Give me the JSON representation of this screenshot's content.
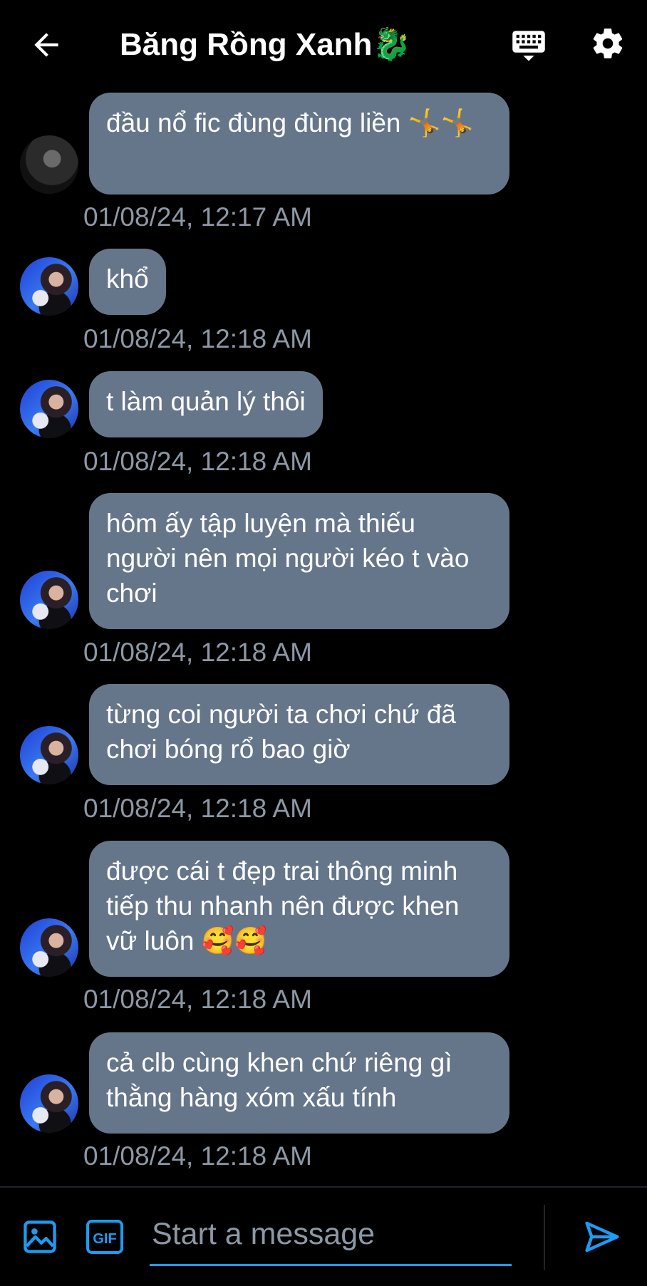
{
  "header": {
    "title": "Băng Rồng Xanh🐉",
    "back_icon": "arrow-left-icon",
    "keyboard_icon": "keyboard-icon",
    "settings_icon": "gear-icon"
  },
  "colors": {
    "bubble": "#66768a",
    "timestamp": "#8d98a6",
    "accent": "#1d9bf0",
    "background": "#000000"
  },
  "messages": [
    {
      "text": "đầu nổ fic đùng đùng liền 🤸🤸",
      "time": "01/08/24, 12:17 AM",
      "avatar": "avatar-dark"
    },
    {
      "text": "khổ",
      "time": "01/08/24, 12:18 AM",
      "avatar": "avatar-blue"
    },
    {
      "text": "t làm quản lý thôi",
      "time": "01/08/24, 12:18 AM",
      "avatar": "avatar-blue"
    },
    {
      "text": "hôm ấy tập luyện mà thiếu người nên mọi người kéo t vào chơi",
      "time": "01/08/24, 12:18 AM",
      "avatar": "avatar-blue"
    },
    {
      "text": "từng coi người ta chơi chứ đã chơi bóng rổ bao giờ",
      "time": "01/08/24, 12:18 AM",
      "avatar": "avatar-blue"
    },
    {
      "text": "được cái t đẹp trai thông minh tiếp thu nhanh nên được khen vữ luôn 🥰🥰",
      "time": "01/08/24, 12:18 AM",
      "avatar": "avatar-blue"
    },
    {
      "text": "cả clb cùng khen chứ riêng gì thằng hàng xóm xấu tính",
      "time": "01/08/24, 12:18 AM",
      "avatar": "avatar-blue"
    }
  ],
  "composer": {
    "placeholder": "Start a message",
    "gif_label": "GIF",
    "image_icon": "image-icon",
    "send_icon": "send-icon"
  }
}
